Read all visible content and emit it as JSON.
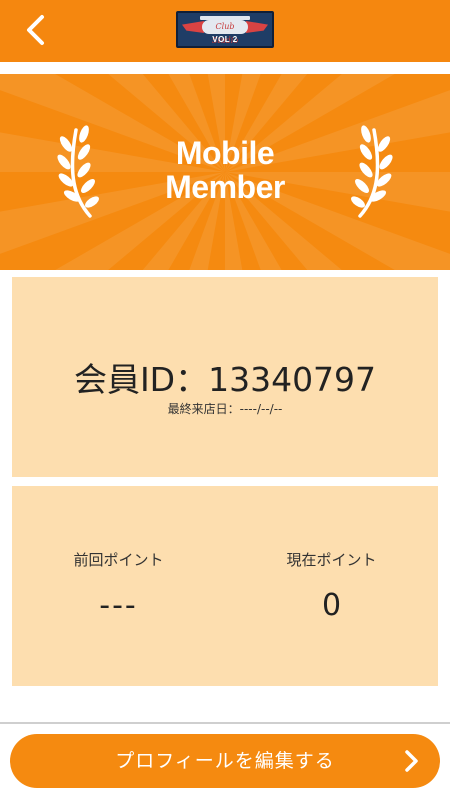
{
  "header": {
    "back_icon": "chevron-left-icon",
    "logo": {
      "script_text": "Club Studio",
      "vol_text": "VOL 2"
    }
  },
  "banner": {
    "title_line1": "Mobile",
    "title_line2": "Member",
    "decoration_icon": "laurel-icon"
  },
  "member": {
    "id_text": "会員ID：13340797",
    "last_visit_text": "最終来店日：----/--/--"
  },
  "points": {
    "previous": {
      "label": "前回ポイント",
      "value": "---"
    },
    "current": {
      "label": "現在ポイント",
      "value": "0"
    }
  },
  "footer": {
    "edit_profile_label": "プロフィールを編集する",
    "edit_profile_icon": "chevron-right-icon"
  },
  "colors": {
    "primary": "#f5870f",
    "card_bg": "#fddeaf",
    "text": "#222222",
    "on_primary": "#ffffff"
  }
}
